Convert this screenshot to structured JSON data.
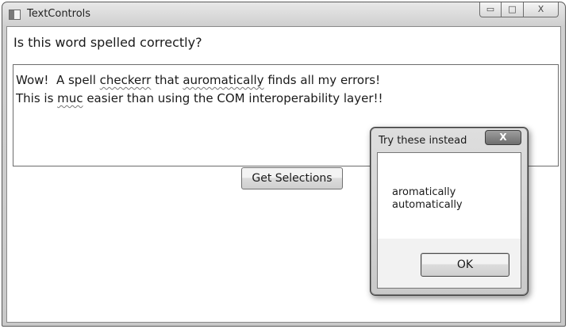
{
  "window": {
    "title": "TextControls",
    "minimize_glyph": "▭",
    "maximize_glyph": "□",
    "close_glyph": "X"
  },
  "main": {
    "question": "Is this word spelled correctly?",
    "textbox": {
      "line1": {
        "before_1": "Wow!  A spell ",
        "misspelled_1": "checkerr",
        "between": " that ",
        "misspelled_2": "auromatically",
        "after": " finds all my errors!"
      },
      "line2": {
        "before": "This is ",
        "misspelled": "muc",
        "after": " easier than using the COM interoperability layer!!"
      }
    },
    "get_selections_label": "Get Selections"
  },
  "dialog": {
    "title": "Try these instead",
    "close_glyph": "X",
    "suggestions": [
      "aromatically",
      "automatically"
    ],
    "ok_label": "OK"
  }
}
